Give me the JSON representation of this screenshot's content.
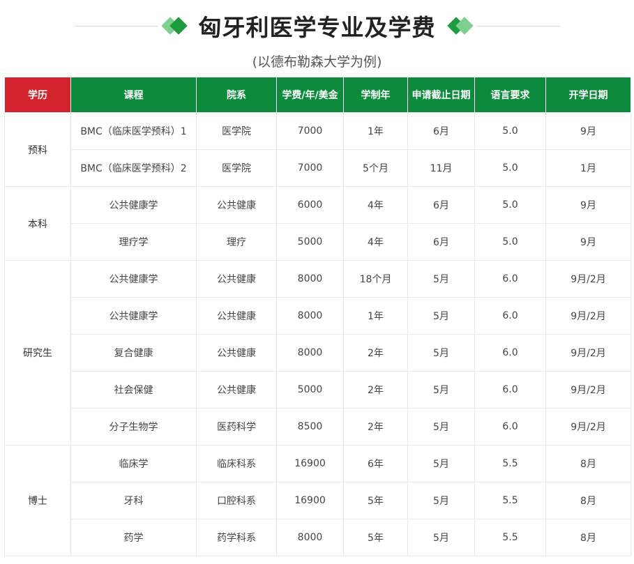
{
  "header": {
    "title": "匈牙利医学专业及学费",
    "subtitle": "(以德布勒森大学为例)"
  },
  "colors": {
    "green": "#0e8a3c",
    "red": "#d3232c",
    "light_green": "#7ed08f"
  },
  "table": {
    "columns": [
      "学历",
      "课程",
      "院系",
      "学费/年/美金",
      "学制年",
      "申请截止日期",
      "语言要求",
      "开学日期"
    ],
    "groups": [
      {
        "level": "预科",
        "rows": [
          {
            "course": "BMC（临床医学预科）1",
            "dept": "医学院",
            "fee": "7000",
            "duration": "1年",
            "deadline": "6月",
            "language": "5.0",
            "start": "9月"
          },
          {
            "course": "BMC（临床医学预科）2",
            "dept": "医学院",
            "fee": "7000",
            "duration": "5个月",
            "deadline": "11月",
            "language": "5.0",
            "start": "1月"
          }
        ]
      },
      {
        "level": "本科",
        "rows": [
          {
            "course": "公共健康学",
            "dept": "公共健康",
            "fee": "6000",
            "duration": "4年",
            "deadline": "6月",
            "language": "5.0",
            "start": "9月"
          },
          {
            "course": "理疗学",
            "dept": "理疗",
            "fee": "5000",
            "duration": "4年",
            "deadline": "6月",
            "language": "5.0",
            "start": "9月"
          }
        ]
      },
      {
        "level": "研究生",
        "rows": [
          {
            "course": "公共健康学",
            "dept": "公共健康",
            "fee": "8000",
            "duration": "18个月",
            "deadline": "5月",
            "language": "6.0",
            "start": "9月/2月"
          },
          {
            "course": "公共健康学",
            "dept": "公共健康",
            "fee": "8000",
            "duration": "1年",
            "deadline": "5月",
            "language": "6.0",
            "start": "9月/2月"
          },
          {
            "course": "复合健康",
            "dept": "公共健康",
            "fee": "8000",
            "duration": "2年",
            "deadline": "5月",
            "language": "6.0",
            "start": "9月/2月"
          },
          {
            "course": "社会保健",
            "dept": "公共健康",
            "fee": "5000",
            "duration": "2年",
            "deadline": "5月",
            "language": "6.0",
            "start": "9月/2月"
          },
          {
            "course": "分子生物学",
            "dept": "医药科学",
            "fee": "8500",
            "duration": "2年",
            "deadline": "5月",
            "language": "6.0",
            "start": "9月/2月"
          }
        ]
      },
      {
        "level": "博士",
        "rows": [
          {
            "course": "临床学",
            "dept": "临床科系",
            "fee": "16900",
            "duration": "6年",
            "deadline": "5月",
            "language": "5.5",
            "start": "8月"
          },
          {
            "course": "牙科",
            "dept": "口腔科系",
            "fee": "16900",
            "duration": "5年",
            "deadline": "5月",
            "language": "5.5",
            "start": "8月"
          },
          {
            "course": "药学",
            "dept": "药学科系",
            "fee": "8000",
            "duration": "5年",
            "deadline": "5月",
            "language": "5.5",
            "start": "8月"
          }
        ]
      }
    ]
  }
}
